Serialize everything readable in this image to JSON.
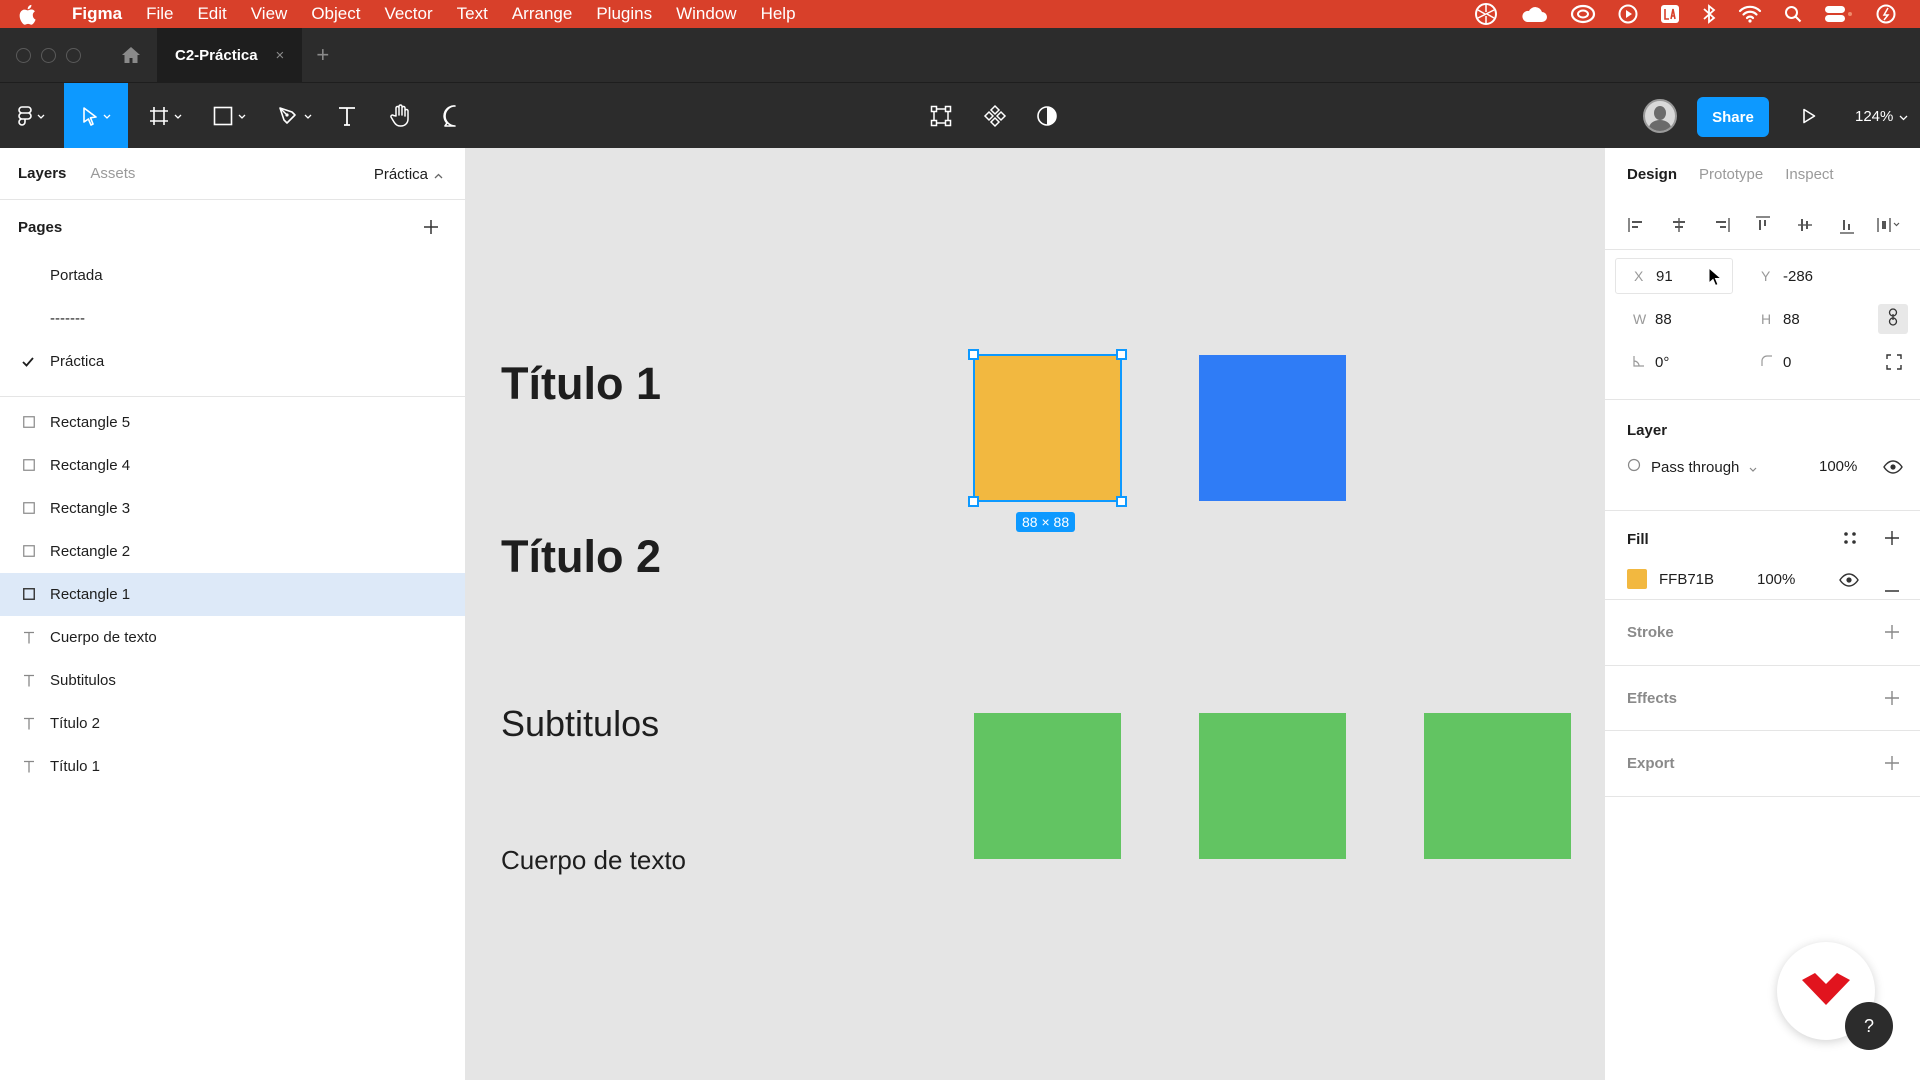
{
  "menubar": {
    "app_name": "Figma",
    "items": [
      "File",
      "Edit",
      "View",
      "Object",
      "Vector",
      "Text",
      "Arrange",
      "Plugins",
      "Window",
      "Help"
    ]
  },
  "tabbar": {
    "tab_title": "C2-Práctica",
    "close_glyph": "×",
    "add_glyph": "+"
  },
  "toolbar": {
    "share_label": "Share",
    "zoom_label": "124%",
    "active_tool": "move"
  },
  "left_panel": {
    "tabs": [
      "Layers",
      "Assets"
    ],
    "page_selector": "Práctica",
    "pages_header": "Pages",
    "pages": [
      {
        "label": "Portada"
      },
      {
        "label": "-------"
      },
      {
        "label": "Práctica",
        "current": true
      }
    ],
    "layers": [
      {
        "label": "Rectangle 5",
        "kind": "rectangle"
      },
      {
        "label": "Rectangle 4",
        "kind": "rectangle"
      },
      {
        "label": "Rectangle 3",
        "kind": "rectangle"
      },
      {
        "label": "Rectangle 2",
        "kind": "rectangle"
      },
      {
        "label": "Rectangle 1",
        "kind": "rectangle",
        "selected": true
      },
      {
        "label": "Cuerpo de texto",
        "kind": "text"
      },
      {
        "label": "Subtitulos",
        "kind": "text"
      },
      {
        "label": "Título 2",
        "kind": "text"
      },
      {
        "label": "Título 1",
        "kind": "text"
      }
    ]
  },
  "canvas": {
    "titulo1": "Título 1",
    "titulo2": "Título 2",
    "subtitulos": "Subtitulos",
    "cuerpo": "Cuerpo de texto",
    "selection_size": "88 × 88",
    "colors": {
      "yellow": "#F2B840",
      "blue": "#2F7CF6",
      "green": "#62C462",
      "selection": "#0D99FF"
    }
  },
  "right_panel": {
    "tabs": [
      "Design",
      "Prototype",
      "Inspect"
    ],
    "x_label": "X",
    "x_value": "91",
    "y_label": "Y",
    "y_value": "-286",
    "w_label": "W",
    "w_value": "88",
    "h_label": "H",
    "h_value": "88",
    "rotation_value": "0°",
    "radius_value": "0",
    "layer_title": "Layer",
    "blend_mode": "Pass through",
    "layer_opacity": "100%",
    "fill_title": "Fill",
    "fill_hex": "FFB71B",
    "fill_color": "#F2B840",
    "fill_opacity": "100%",
    "stroke_title": "Stroke",
    "effects_title": "Effects",
    "export_title": "Export"
  },
  "help_label": "?"
}
